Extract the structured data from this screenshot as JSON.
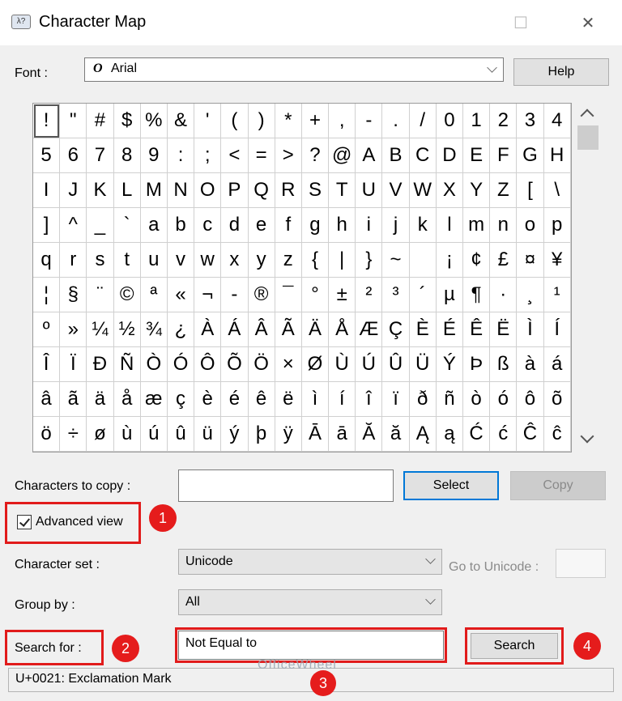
{
  "window": {
    "title": "Character Map",
    "icon": "charmap-app-icon",
    "app_icon_glyph": "λ?",
    "maximize_glyph": "☐",
    "close_glyph": "✕"
  },
  "font": {
    "label": "Font :",
    "value": "Arial",
    "value_icon": "O",
    "help_label": "Help"
  },
  "grid": {
    "rows": [
      [
        "!",
        "\"",
        "#",
        "$",
        "%",
        "&",
        "'",
        "(",
        ")",
        "*",
        "+",
        ",",
        "-",
        ".",
        "/",
        "0",
        "1",
        "2",
        "3",
        "4"
      ],
      [
        "5",
        "6",
        "7",
        "8",
        "9",
        ":",
        ";",
        "<",
        "=",
        ">",
        "?",
        "@",
        "A",
        "B",
        "C",
        "D",
        "E",
        "F",
        "G",
        "H"
      ],
      [
        "I",
        "J",
        "K",
        "L",
        "M",
        "N",
        "O",
        "P",
        "Q",
        "R",
        "S",
        "T",
        "U",
        "V",
        "W",
        "X",
        "Y",
        "Z",
        "[",
        "\\"
      ],
      [
        "]",
        "^",
        "_",
        "`",
        "a",
        "b",
        "c",
        "d",
        "e",
        "f",
        "g",
        "h",
        "i",
        "j",
        "k",
        "l",
        "m",
        "n",
        "o",
        "p"
      ],
      [
        "q",
        "r",
        "s",
        "t",
        "u",
        "v",
        "w",
        "x",
        "y",
        "z",
        "{",
        "|",
        "}",
        "~",
        " ",
        "¡",
        "¢",
        "£",
        "¤",
        "¥"
      ],
      [
        "¦",
        "§",
        "¨",
        "©",
        "ª",
        "«",
        "¬",
        "-",
        "®",
        "¯",
        "°",
        "±",
        "²",
        "³",
        "´",
        "µ",
        "¶",
        "·",
        "¸",
        "¹"
      ],
      [
        "º",
        "»",
        "¼",
        "½",
        "¾",
        "¿",
        "À",
        "Á",
        "Â",
        "Ã",
        "Ä",
        "Å",
        "Æ",
        "Ç",
        "È",
        "É",
        "Ê",
        "Ë",
        "Ì",
        "Í"
      ],
      [
        "Î",
        "Ï",
        "Ð",
        "Ñ",
        "Ò",
        "Ó",
        "Ô",
        "Õ",
        "Ö",
        "×",
        "Ø",
        "Ù",
        "Ú",
        "Û",
        "Ü",
        "Ý",
        "Þ",
        "ß",
        "à",
        "á"
      ],
      [
        "â",
        "ã",
        "ä",
        "å",
        "æ",
        "ç",
        "è",
        "é",
        "ê",
        "ë",
        "ì",
        "í",
        "î",
        "ï",
        "ð",
        "ñ",
        "ò",
        "ó",
        "ô",
        "õ"
      ],
      [
        "ö",
        "÷",
        "ø",
        "ù",
        "ú",
        "û",
        "ü",
        "ý",
        "þ",
        "ÿ",
        "Ā",
        "ā",
        "Ă",
        "ă",
        "Ą",
        "ą",
        "Ć",
        "ć",
        "Ĉ",
        "ĉ"
      ]
    ],
    "selected": "!"
  },
  "copy": {
    "label": "Characters to copy :",
    "value": "",
    "select_label": "Select",
    "copy_label": "Copy"
  },
  "advanced": {
    "label": "Advanced view",
    "checked": true
  },
  "charset": {
    "label": "Character set :",
    "value": "Unicode",
    "goto_label": "Go to Unicode :",
    "goto_value": ""
  },
  "groupby": {
    "label": "Group by :",
    "value": "All"
  },
  "search": {
    "label": "Search for :",
    "value": "Not Equal to",
    "button_label": "Search"
  },
  "status": {
    "text": "U+0021: Exclamation Mark"
  },
  "badges": [
    "1",
    "2",
    "3",
    "4"
  ],
  "watermark": "OfficeWheel",
  "colors": {
    "highlight": "#e11b1b",
    "focus": "#0078d7"
  }
}
